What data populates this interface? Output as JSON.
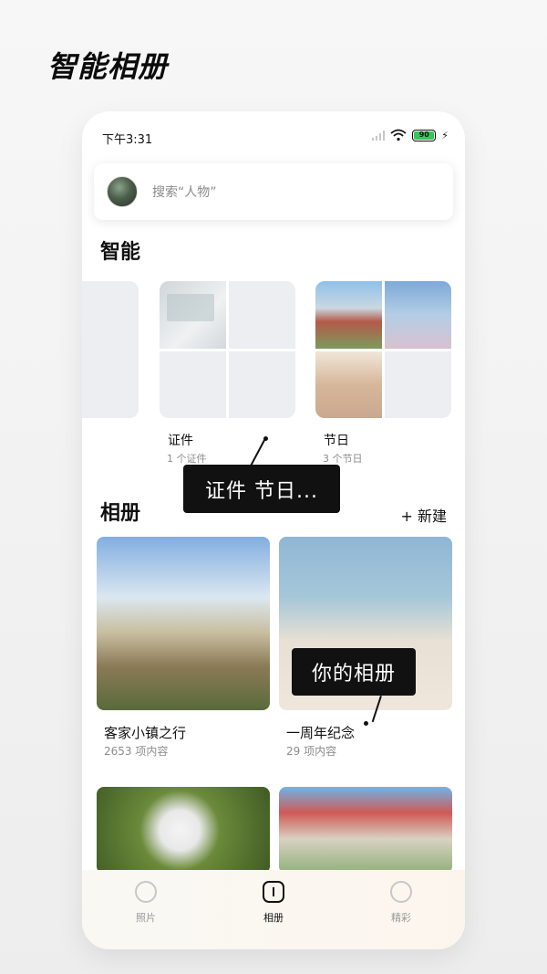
{
  "hero": {
    "title": "智能相册"
  },
  "status": {
    "time": "下午3:31",
    "battery": "90"
  },
  "search": {
    "placeholder": "搜索“人物”"
  },
  "smart": {
    "title": "智能",
    "cards": [
      {
        "label": "证件",
        "count": "1 个证件"
      },
      {
        "label": "节日",
        "count": "3 个节日"
      }
    ],
    "tooltip": "证件  节日..."
  },
  "albums": {
    "title": "相册",
    "new_label": "+ 新建",
    "tooltip": "你的相册",
    "items": [
      {
        "name": "客家小镇之行",
        "count": "2653 项内容"
      },
      {
        "name": "一周年纪念",
        "count": "29 项内容"
      }
    ]
  },
  "nav": {
    "items": [
      {
        "label": "照片"
      },
      {
        "label": "相册"
      },
      {
        "label": "精彩"
      }
    ]
  },
  "colors": {
    "battery": "#34c759",
    "active": "#111111",
    "inactive": "#9a9a9a"
  }
}
